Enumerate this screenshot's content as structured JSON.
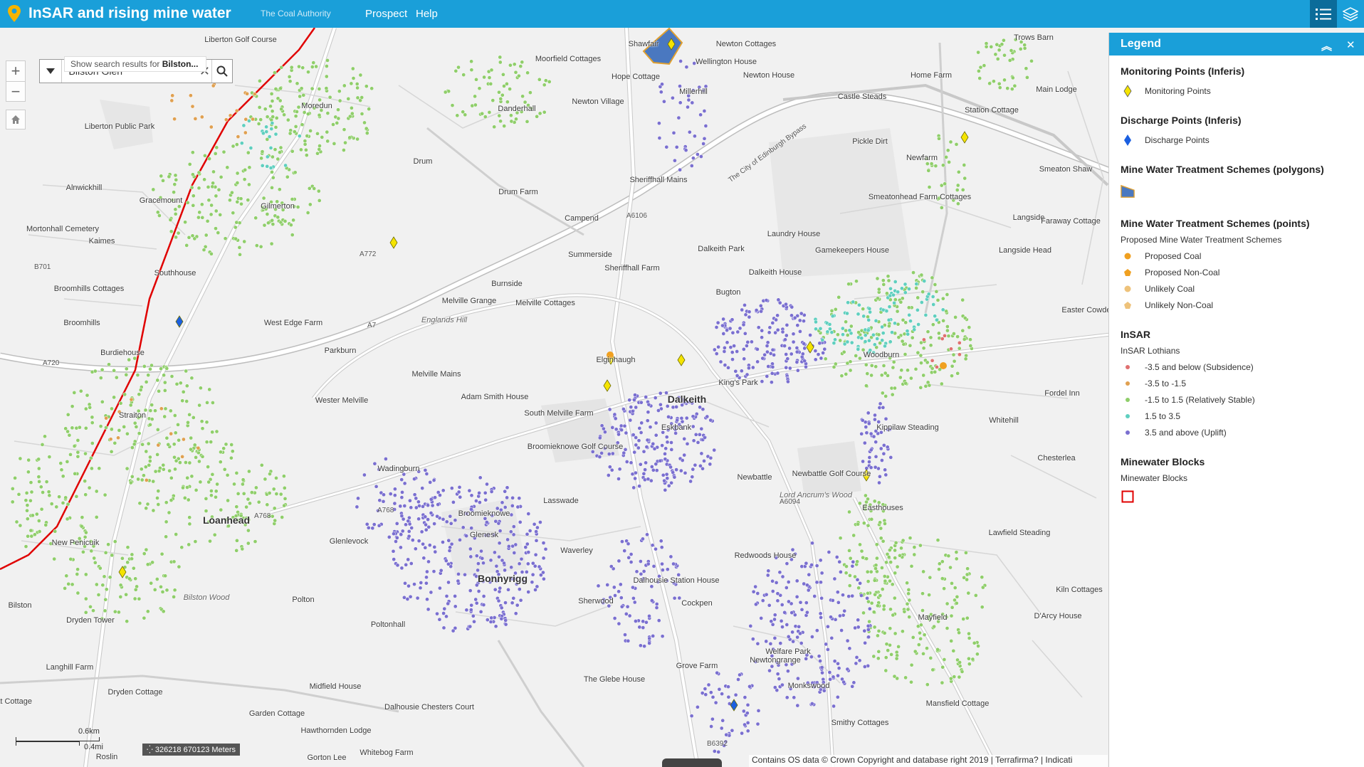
{
  "header": {
    "title": "InSAR and rising mine water",
    "subtitle": "The Coal Authority",
    "nav": [
      "Prospect",
      "Help"
    ]
  },
  "search": {
    "value": "Bilston Glen",
    "hint_prefix": "Show search results for",
    "hint_term": "Bilston..."
  },
  "map": {
    "places": [
      {
        "t": "Liberton Golf Course"
      },
      {
        "t": "Moredun"
      },
      {
        "t": "Liberton Public Park"
      },
      {
        "t": "Alnwickhill"
      },
      {
        "t": "Gracemount"
      },
      {
        "t": "Mortonhall Cemetery"
      },
      {
        "t": "Kaimes"
      },
      {
        "t": "Gilmerton"
      },
      {
        "t": "Broomhills Cottages"
      },
      {
        "t": "Southhouse"
      },
      {
        "t": "Broomhills"
      },
      {
        "t": "Burdiehouse"
      },
      {
        "t": "Straiton"
      },
      {
        "t": "Loanhead",
        "big": true
      },
      {
        "t": "New Penicuik"
      },
      {
        "t": "Bilston"
      },
      {
        "t": "Bilston Wood",
        "it": true
      },
      {
        "t": "Dryden Tower"
      },
      {
        "t": "Langhill Farm"
      },
      {
        "t": "Dryden Cottage"
      },
      {
        "t": "Moat Cottage"
      },
      {
        "t": "Roslin"
      },
      {
        "t": "Moorfield Cottages"
      },
      {
        "t": "Danderhall"
      },
      {
        "t": "Drum"
      },
      {
        "t": "Drum Farm"
      },
      {
        "t": "Newton Village"
      },
      {
        "t": "Hope Cottage"
      },
      {
        "t": "Millerhill"
      },
      {
        "t": "Newton Cottages"
      },
      {
        "t": "Wellington House"
      },
      {
        "t": "Newton House"
      },
      {
        "t": "Shawfair"
      },
      {
        "t": "Sheriffhall Mains"
      },
      {
        "t": "Campend"
      },
      {
        "t": "Summerside"
      },
      {
        "t": "Sheriffhall Farm"
      },
      {
        "t": "Burnside"
      },
      {
        "t": "Melville Grange"
      },
      {
        "t": "Melville Cottages"
      },
      {
        "t": "Englands Hill",
        "it": true
      },
      {
        "t": "West Edge Farm"
      },
      {
        "t": "Parkburn"
      },
      {
        "t": "Wester Melville"
      },
      {
        "t": "Melville Mains"
      },
      {
        "t": "Adam Smith House"
      },
      {
        "t": "Elginhaugh"
      },
      {
        "t": "South Melville Farm"
      },
      {
        "t": "Broomieknowe Golf Course"
      },
      {
        "t": "Dalkeith",
        "big": true
      },
      {
        "t": "Eskbank"
      },
      {
        "t": "Wadingburn"
      },
      {
        "t": "Lasswade"
      },
      {
        "t": "Broomieknowe"
      },
      {
        "t": "Glenesk"
      },
      {
        "t": "Glenlevock"
      },
      {
        "t": "Bonnyrigg",
        "big": true
      },
      {
        "t": "Waverley"
      },
      {
        "t": "Polton"
      },
      {
        "t": "Poltonhall"
      },
      {
        "t": "Sherwood"
      },
      {
        "t": "Dalhousie Station House"
      },
      {
        "t": "Cockpen"
      },
      {
        "t": "Hawthornden Lodge"
      },
      {
        "t": "Midfield House"
      },
      {
        "t": "Dalhousie Chesters Court"
      },
      {
        "t": "Garden Cottage"
      },
      {
        "t": "Gorton Lee"
      },
      {
        "t": "Whitebog Farm"
      },
      {
        "t": "Grove Farm"
      },
      {
        "t": "The Glebe House"
      },
      {
        "t": "Newtongrange"
      },
      {
        "t": "Welfare Park"
      },
      {
        "t": "Monkswood"
      },
      {
        "t": "Smithy Cottages"
      },
      {
        "t": "Newbattle"
      },
      {
        "t": "Newbattle Golf Course"
      },
      {
        "t": "Lord Ancrum's Wood",
        "it": true
      },
      {
        "t": "Redwoods House"
      },
      {
        "t": "Easthouses"
      },
      {
        "t": "Mayfield"
      },
      {
        "t": "Mansfield Cottage"
      },
      {
        "t": "Woodburn"
      },
      {
        "t": "Dalkeith Park"
      },
      {
        "t": "Dalkeith House"
      },
      {
        "t": "Bugton"
      },
      {
        "t": "King's Park"
      },
      {
        "t": "Laundry House"
      },
      {
        "t": "Gamekeepers House"
      },
      {
        "t": "Castle Steads"
      },
      {
        "t": "Pickle Dirt"
      },
      {
        "t": "Newfarm"
      },
      {
        "t": "Smeatonhead Farm Cottages"
      },
      {
        "t": "Home Farm"
      },
      {
        "t": "Station Cottage"
      },
      {
        "t": "Smeaton Shaw"
      },
      {
        "t": "Langside"
      },
      {
        "t": "Faraway Cottage"
      },
      {
        "t": "Langside Head"
      },
      {
        "t": "Easter Cowden"
      },
      {
        "t": "Kippilaw Steading"
      },
      {
        "t": "Whitehill"
      },
      {
        "t": "Fordel Inn"
      },
      {
        "t": "Chesterlea"
      },
      {
        "t": "Lawfield Steading"
      },
      {
        "t": "Kiln Cottages"
      },
      {
        "t": "D'Arcy House"
      },
      {
        "t": "Trows Barn"
      },
      {
        "t": "Main Lodge"
      }
    ],
    "road_labels": [
      "A720",
      "A772",
      "A768",
      "A6106",
      "B6392",
      "A6094",
      "The City of Edinburgh Bypass",
      "A7",
      "A768",
      "B701"
    ],
    "scale_km": "0.6km",
    "scale_mi": "0.4mi",
    "coords": "326218 670123 Meters",
    "attribution": "Contains OS data © Crown Copyright and database right 2019 | Terrafirma? | Indicati"
  },
  "legend": {
    "title": "Legend",
    "sections": [
      {
        "title": "Monitoring Points (Inferis)",
        "items": [
          {
            "label": "Monitoring Points",
            "sym": "diamond-yellow"
          }
        ]
      },
      {
        "title": "Discharge Points (Inferis)",
        "items": [
          {
            "label": "Discharge Points",
            "sym": "diamond-blue"
          }
        ]
      },
      {
        "title": "Mine Water Treatment Schemes (polygons)",
        "items": [
          {
            "label": "",
            "sym": "polygon-blue"
          }
        ]
      },
      {
        "title": "Mine Water Treatment Schemes (points)",
        "sub": "Proposed Mine Water Treatment Schemes",
        "items": [
          {
            "label": "Proposed Coal",
            "sym": "circle-orange"
          },
          {
            "label": "Proposed Non-Coal",
            "sym": "pentagon-orange"
          },
          {
            "label": "Unlikely Coal",
            "sym": "circle-tan"
          },
          {
            "label": "Unlikely Non-Coal",
            "sym": "pentagon-tan"
          }
        ]
      },
      {
        "title": "InSAR",
        "sub": "InSAR Lothians",
        "items": [
          {
            "label": "-3.5 and below (Subsidence)",
            "sym": "dot-red"
          },
          {
            "label": "-3.5 to -1.5",
            "sym": "dot-orange"
          },
          {
            "label": "-1.5 to 1.5 (Relatively Stable)",
            "sym": "dot-green"
          },
          {
            "label": "1.5 to 3.5",
            "sym": "dot-teal"
          },
          {
            "label": "3.5 and above (Uplift)",
            "sym": "dot-purple"
          }
        ]
      },
      {
        "title": "Minewater Blocks",
        "sub": "Minewater Blocks",
        "items": [
          {
            "label": "",
            "sym": "square-red"
          }
        ]
      }
    ]
  },
  "colors": {
    "header": "#1a9fd9",
    "subsidence": "#e07070",
    "minor_subsidence": "#e0a050",
    "stable": "#8fce6a",
    "minor_uplift": "#5fcfbf",
    "uplift": "#7a6fd0",
    "monitoring": "#f5e400",
    "discharge": "#1b5fe0",
    "minewater_block": "#e00000"
  }
}
